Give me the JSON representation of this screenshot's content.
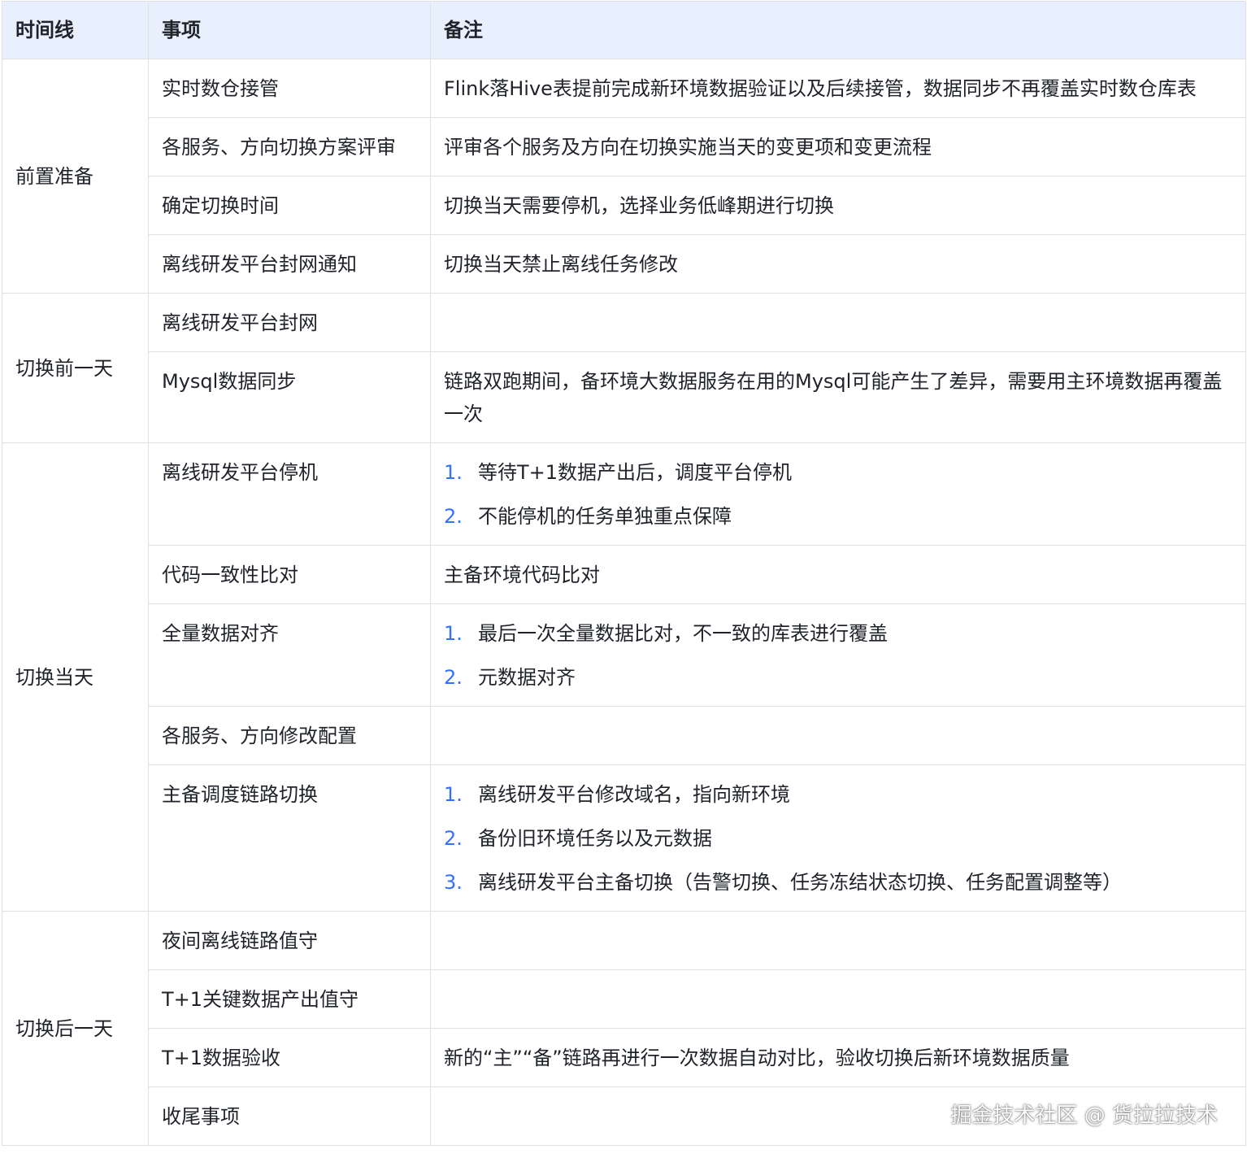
{
  "header": {
    "timeline": "时间线",
    "task": "事项",
    "note": "备注"
  },
  "phases": [
    {
      "name": "前置准备",
      "rows": [
        {
          "task": "实时数仓接管",
          "note": "Flink落Hive表提前完成新环境数据验证以及后续接管，数据同步不再覆盖实时数仓库表"
        },
        {
          "task": "各服务、方向切换方案评审",
          "note": "评审各个服务及方向在切换实施当天的变更项和变更流程"
        },
        {
          "task": "确定切换时间",
          "note": "切换当天需要停机，选择业务低峰期进行切换"
        },
        {
          "task": "离线研发平台封网通知",
          "note": "切换当天禁止离线任务修改"
        }
      ]
    },
    {
      "name": "切换前一天",
      "rows": [
        {
          "task": "离线研发平台封网",
          "note": ""
        },
        {
          "task": "Mysql数据同步",
          "note": "链路双跑期间，备环境大数据服务在用的Mysql可能产生了差异，需要用主环境数据再覆盖一次"
        }
      ]
    },
    {
      "name": "切换当天",
      "rows": [
        {
          "task": "离线研发平台停机",
          "steps": [
            "等待T+1数据产出后，调度平台停机",
            "不能停机的任务单独重点保障"
          ]
        },
        {
          "task": "代码一致性比对",
          "note": "主备环境代码比对"
        },
        {
          "task": "全量数据对齐",
          "steps": [
            "最后一次全量数据比对，不一致的库表进行覆盖",
            "元数据对齐"
          ]
        },
        {
          "task": "各服务、方向修改配置",
          "note": ""
        },
        {
          "task": "主备调度链路切换",
          "steps": [
            "离线研发平台修改域名，指向新环境",
            "备份旧环境任务以及元数据",
            "离线研发平台主备切换（告警切换、任务冻结状态切换、任务配置调整等）"
          ]
        }
      ]
    },
    {
      "name": "切换后一天",
      "rows": [
        {
          "task": "夜间离线链路值守",
          "note": ""
        },
        {
          "task": "T+1关键数据产出值守",
          "note": ""
        },
        {
          "task": "T+1数据验收",
          "note": "新的“主”“备”链路再进行一次数据自动对比，验收切换后新环境数据质量"
        },
        {
          "task": "收尾事项",
          "note": ""
        }
      ]
    }
  ],
  "footer": {
    "credit": "掘金技术社区 @ 货拉拉技术"
  },
  "colors": {
    "header_bg": "#e8effd",
    "border": "#dee0e3",
    "list_number": "#3370ff"
  }
}
